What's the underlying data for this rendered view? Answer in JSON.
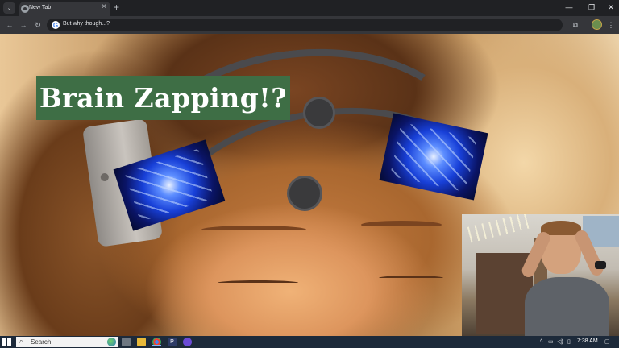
{
  "browser": {
    "tab": {
      "title": "New Tab"
    },
    "address_bar": {
      "text": "But why though...?"
    }
  },
  "page": {
    "banner": {
      "title": "Brain Zapping!?"
    }
  },
  "taskbar": {
    "search_label": "Search",
    "clock": "7:38 AM"
  },
  "colors": {
    "banner_bg": "#3e6e45",
    "browser_dark": "#202124",
    "taskbar_bg": "#1d2a3a"
  },
  "icons": {
    "tab_search": "chevron-down-icon",
    "back": "arrow-left-icon",
    "forward": "arrow-right-icon",
    "reload": "reload-icon",
    "google": "google-g-icon",
    "extensions": "puzzle-piece-icon",
    "menu": "kebab-menu-icon"
  }
}
